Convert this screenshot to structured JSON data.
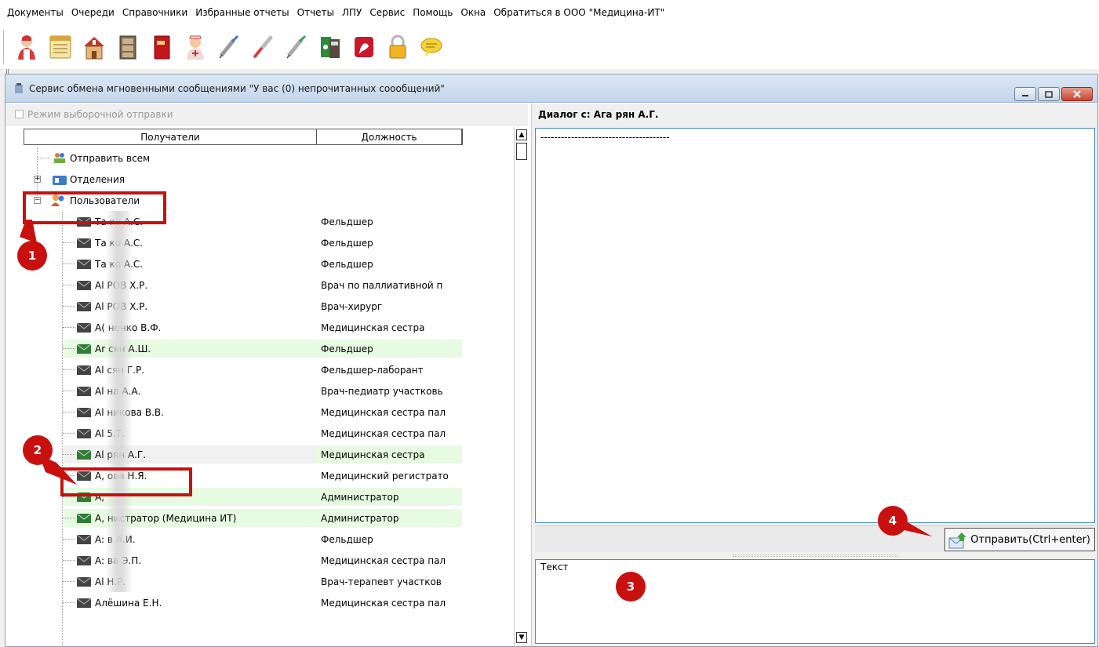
{
  "menu": [
    "Документы",
    "Очереди",
    "Справочники",
    "Избранные отчеты",
    "Отчеты",
    "ЛПУ",
    "Сервис",
    "Помощь",
    "Окна",
    "Обратиться в ООО \"Медицина-ИТ\""
  ],
  "toolbar_icons": [
    "doctor-icon",
    "journal-icon",
    "building-icon",
    "cabinet-icon",
    "book-icon",
    "nurse-icon",
    "syringe-icon",
    "thermometer-icon",
    "syringe-icon",
    "calculator-icon",
    "report-icon",
    "lock-icon",
    "chat-icon"
  ],
  "window": {
    "title": "Сервис обмена мгновенными сообщениями \"У вас (0) непрочитанных соообщений\""
  },
  "left": {
    "selective_mode_label": "Режим выборочной отправки",
    "col_recipients": "Получатели",
    "col_position": "Должность",
    "groups": {
      "send_all": "Отправить всем",
      "departments": "Отделения",
      "users": "Пользователи"
    },
    "users": [
      {
        "name": "Та      ко А.С.",
        "position": "Фельдшер",
        "state": ""
      },
      {
        "name": "Та      ко А.С.",
        "position": "Фельдшер",
        "state": ""
      },
      {
        "name": "Та      ко А.С.",
        "position": "Фельдшер",
        "state": ""
      },
      {
        "name": "Al      РОВ Х.Р.",
        "position": "Врач по паллиативной п",
        "state": ""
      },
      {
        "name": "Al      РОВ Х.Р.",
        "position": "Врач-хирург",
        "state": ""
      },
      {
        "name": "A(      ненко В.Ф.",
        "position": "Медицинская сестра",
        "state": ""
      },
      {
        "name": "Ar      сян А.Ш.",
        "position": "Фельдшер",
        "state": "green"
      },
      {
        "name": "Al      сян Г.Р.",
        "position": "Фельдшер-лаборант",
        "state": ""
      },
      {
        "name": "Al      на А.А.",
        "position": "Врач-педиатр участковь",
        "state": ""
      },
      {
        "name": "Al      никова В.В.",
        "position": "Медицинская сестра пал",
        "state": ""
      },
      {
        "name": "Al      5.Т.",
        "position": "Медицинская сестра пал",
        "state": ""
      },
      {
        "name": "Al      рян А.Г.",
        "position": "Медицинская сестра",
        "state": "sel"
      },
      {
        "name": "A,      ова Н.Я.",
        "position": "Медицинский регистрато",
        "state": ""
      },
      {
        "name": "A,      ",
        "position": "Администратор",
        "state": "green"
      },
      {
        "name": "A,      нистратор (Медицина ИТ)",
        "position": "Администратор",
        "state": "green"
      },
      {
        "name": "A:      в А.И.",
        "position": "Фельдшер",
        "state": ""
      },
      {
        "name": "A:      ва Э.П.",
        "position": "Медицинская сестра пал",
        "state": ""
      },
      {
        "name": "Al      Н.Р.",
        "position": "Врач-терапевт участков",
        "state": ""
      },
      {
        "name": "Алёшина Е.Н.",
        "position": "Медицинская сестра пал",
        "state": ""
      }
    ]
  },
  "right": {
    "dialog_label": "Диалог с:",
    "dialog_name": "Ага      рян А.Г.",
    "history": "--------------------------------------",
    "send_button": "Отправить(Ctrl+enter)",
    "input_text": "Текст"
  },
  "callouts": [
    "1",
    "2",
    "3",
    "4"
  ],
  "colors": {
    "accent": "#c8100f",
    "row_green": "#e6fbe1",
    "border_blue": "#4a8ad0"
  }
}
